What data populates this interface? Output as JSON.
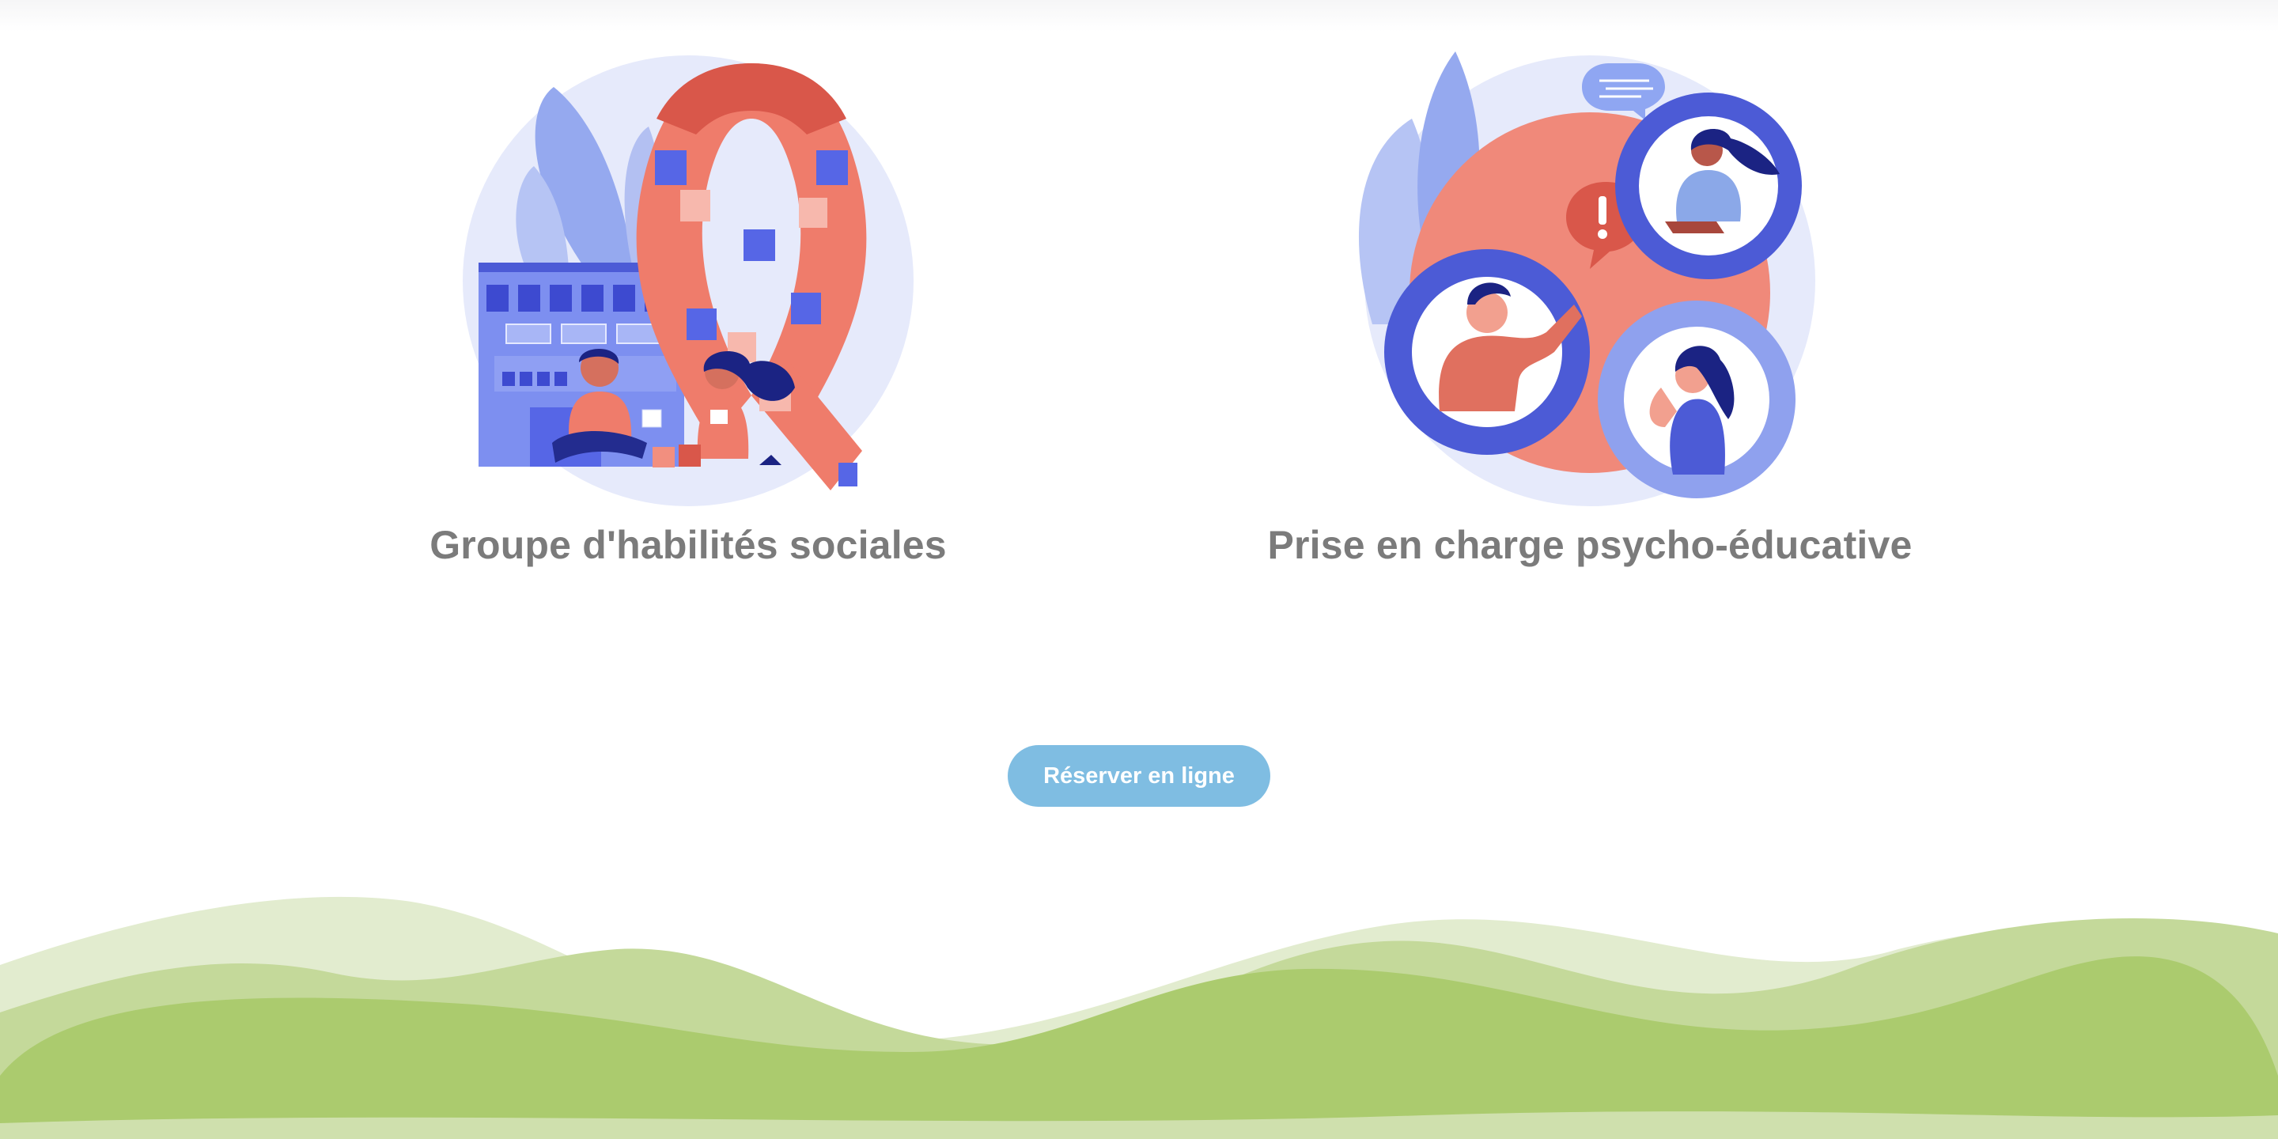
{
  "services": [
    {
      "title": "Groupe d'habilités sociales",
      "illustration": "autism-ribbon-children-illustration"
    },
    {
      "title": "Prise en charge psycho-éducative",
      "illustration": "people-in-gears-illustration"
    }
  ],
  "cta": {
    "label": "Réserver en ligne"
  },
  "colors": {
    "title_text": "#7b7b7b",
    "button_bg": "#7fbde2",
    "hill_light": "#e2eccf",
    "hill_mid": "#c4d99a",
    "hill_dark": "#abcb6e",
    "illustration_blue": "#5666e6",
    "illustration_coral": "#ef7c6b"
  }
}
